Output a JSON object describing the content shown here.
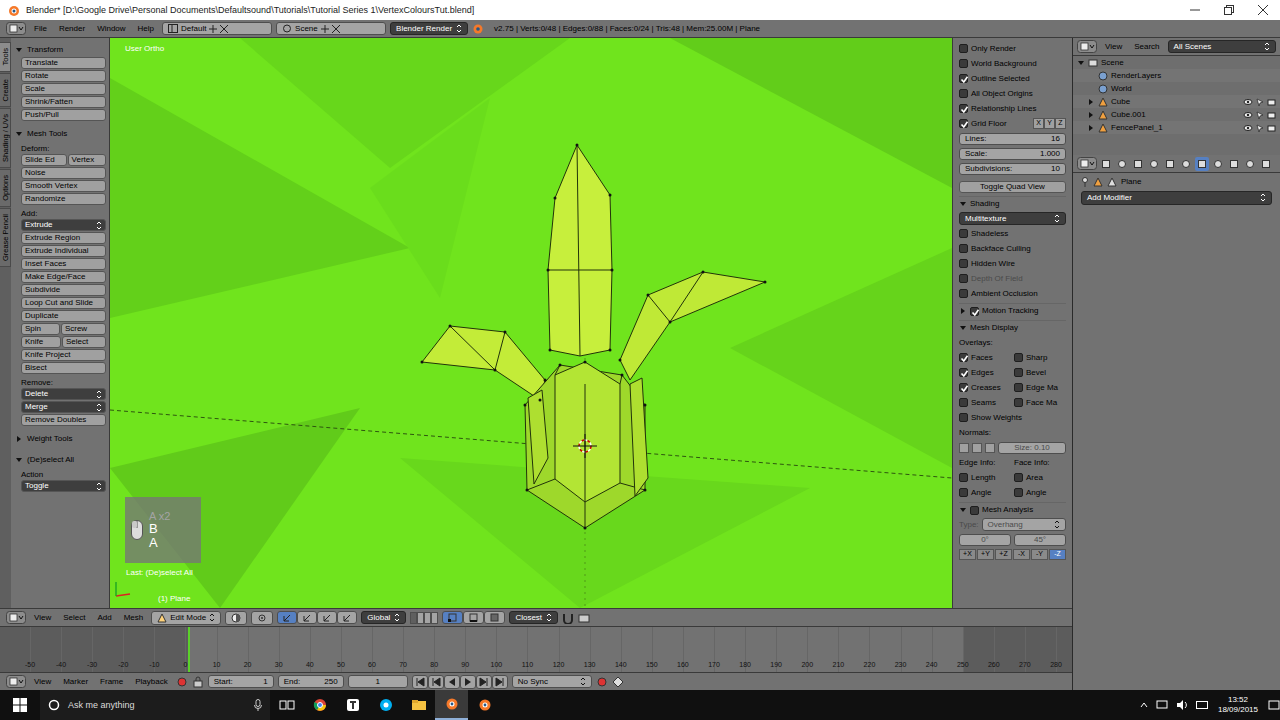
{
  "window": {
    "title": "Blender* [D:\\Google Drive\\Personal Documents\\Defaultsound\\Tutorials\\Tutorial Series 1\\VertexColoursTut.blend]"
  },
  "info_header": {
    "menus": [
      "File",
      "Render",
      "Window",
      "Help"
    ],
    "layout": "Default",
    "scene": "Scene",
    "engine": "Blender Render",
    "stats": "v2.75 | Verts:0/48 | Edges:0/88 | Faces:0/24 | Tris:48 | Mem:25.00M | Plane"
  },
  "tool_shelf": {
    "tabs": [
      {
        "label": "Tools",
        "selected": true
      },
      {
        "label": "Create",
        "selected": false
      },
      {
        "label": "Shading / UVs",
        "selected": false
      },
      {
        "label": "Options",
        "selected": false
      },
      {
        "label": "Grease Pencil",
        "selected": false
      }
    ],
    "panels": [
      {
        "title": "Transform",
        "expanded": true,
        "items": [
          {
            "kind": "button",
            "labels": [
              "Translate"
            ]
          },
          {
            "kind": "button",
            "labels": [
              "Rotate"
            ]
          },
          {
            "kind": "button",
            "labels": [
              "Scale"
            ]
          },
          {
            "kind": "button",
            "labels": [
              "Shrink/Fatten"
            ]
          },
          {
            "kind": "button",
            "labels": [
              "Push/Pull"
            ]
          }
        ]
      },
      {
        "title": "Mesh Tools",
        "expanded": true,
        "items": [
          {
            "kind": "label",
            "labels": [
              "Deform:"
            ]
          },
          {
            "kind": "button",
            "labels": [
              "Slide Ed",
              "Vertex"
            ]
          },
          {
            "kind": "button",
            "labels": [
              "Noise"
            ]
          },
          {
            "kind": "button",
            "labels": [
              "Smooth Vertex"
            ]
          },
          {
            "kind": "button",
            "labels": [
              "Randomize"
            ]
          },
          {
            "kind": "label",
            "labels": [
              "Add:"
            ]
          },
          {
            "kind": "dropdown",
            "labels": [
              "Extrude"
            ]
          },
          {
            "kind": "button",
            "labels": [
              "Extrude Region"
            ]
          },
          {
            "kind": "button",
            "labels": [
              "Extrude Individual"
            ]
          },
          {
            "kind": "button",
            "labels": [
              "Inset Faces"
            ]
          },
          {
            "kind": "button",
            "labels": [
              "Make Edge/Face"
            ]
          },
          {
            "kind": "button",
            "labels": [
              "Subdivide"
            ]
          },
          {
            "kind": "button",
            "labels": [
              "Loop Cut and Slide"
            ]
          },
          {
            "kind": "button",
            "labels": [
              "Duplicate"
            ]
          },
          {
            "kind": "button",
            "labels": [
              "Spin",
              "Screw"
            ]
          },
          {
            "kind": "button",
            "labels": [
              "Knife",
              "Select"
            ]
          },
          {
            "kind": "button",
            "labels": [
              "Knife Project"
            ]
          },
          {
            "kind": "button",
            "labels": [
              "Bisect"
            ]
          },
          {
            "kind": "label",
            "labels": [
              "Remove:"
            ]
          },
          {
            "kind": "dropdown",
            "labels": [
              "Delete"
            ]
          },
          {
            "kind": "dropdown",
            "labels": [
              "Merge"
            ]
          },
          {
            "kind": "button",
            "labels": [
              "Remove Doubles"
            ]
          }
        ]
      },
      {
        "title": "Weight Tools",
        "expanded": false,
        "items": []
      }
    ],
    "operator": {
      "title": "(De)select All",
      "expanded": true,
      "label": "Action",
      "value": "Toggle"
    }
  },
  "viewport": {
    "view_label": "User Ortho",
    "object_label": "(1) Plane",
    "last_operator": "Last: (De)select All",
    "keys": [
      "A x2",
      "B",
      "A"
    ]
  },
  "view_properties": {
    "checks": [
      {
        "label": "Only Render",
        "checked": false
      },
      {
        "label": "World Background",
        "checked": false
      },
      {
        "label": "Outline Selected",
        "checked": true
      },
      {
        "label": "All Object Origins",
        "checked": false
      },
      {
        "label": "Relationship Lines",
        "checked": true
      }
    ],
    "grid_floor": {
      "label": "Grid Floor",
      "checked": true,
      "axes": [
        {
          "label": "X",
          "on": false
        },
        {
          "label": "Y",
          "on": false
        },
        {
          "label": "Z",
          "on": false
        }
      ]
    },
    "fields": [
      {
        "label": "Lines:",
        "value": "16"
      },
      {
        "label": "Scale:",
        "value": "1.000"
      },
      {
        "label": "Subdivisions:",
        "value": "10"
      }
    ],
    "quad_view": "Toggle Quad View",
    "shading_panel": {
      "title": "Shading",
      "expanded": true,
      "mode": "Multitexture",
      "checks": [
        {
          "label": "Shadeless",
          "checked": false,
          "disabled": false
        },
        {
          "label": "Backface Culling",
          "checked": false,
          "disabled": false
        },
        {
          "label": "Hidden Wire",
          "checked": false,
          "disabled": false
        },
        {
          "label": "Depth Of Field",
          "checked": false,
          "disabled": true
        },
        {
          "label": "Ambient Occlusion",
          "checked": false,
          "disabled": false
        }
      ]
    },
    "motion_tracking_panel": {
      "title": "Motion Tracking",
      "expanded": false,
      "checked": true
    },
    "mesh_display_panel": {
      "title": "Mesh Display",
      "expanded": true,
      "overlays_label": "Overlays:",
      "overlays": [
        {
          "label": "Faces",
          "checked": true
        },
        {
          "label": "Sharp",
          "checked": false
        },
        {
          "label": "Edges",
          "checked": true
        },
        {
          "label": "Bevel",
          "checked": false
        },
        {
          "label": "Creases",
          "checked": true
        },
        {
          "label": "Edge Ma",
          "checked": false
        },
        {
          "label": "Seams",
          "checked": false
        },
        {
          "label": "Face Ma",
          "checked": false
        }
      ],
      "show_weights": {
        "label": "Show Weights",
        "checked": false
      },
      "normals_label": "Normals:",
      "normal_buttons": [
        {
          "selected": false
        },
        {
          "selected": false
        },
        {
          "selected": false
        }
      ],
      "normals_size": "Size: 0.10",
      "edge_info_label": "Edge Info:",
      "face_info_label": "Face Info:",
      "edge_info": [
        {
          "label": "Length",
          "checked": false
        },
        {
          "label": "Angle",
          "checked": false
        }
      ],
      "face_info": [
        {
          "label": "Area",
          "checked": false
        },
        {
          "label": "Angle",
          "checked": false
        }
      ]
    },
    "mesh_analysis_panel": {
      "title": "Mesh Analysis",
      "expanded": true,
      "checked": false,
      "type_label": "Type:",
      "type": "Overhang",
      "min": "0°",
      "max": "45°"
    },
    "axis_buttons": [
      {
        "label": "+X",
        "selected": false
      },
      {
        "label": "+Y",
        "selected": false
      },
      {
        "label": "+Z",
        "selected": false
      },
      {
        "label": "-X",
        "selected": false
      },
      {
        "label": "-Y",
        "selected": false
      },
      {
        "label": "-Z",
        "selected": true
      }
    ]
  },
  "outliner": {
    "menus": [
      "View",
      "Search"
    ],
    "filter": "All Scenes",
    "tree": [
      {
        "label": "Scene",
        "expanded": true,
        "children": [
          {
            "label": "RenderLayers"
          },
          {
            "label": "World"
          },
          {
            "label": "Cube",
            "expanded": false
          },
          {
            "label": "Cube.001",
            "expanded": false
          },
          {
            "label": "FencePanel_1",
            "expanded": false
          }
        ]
      }
    ]
  },
  "properties": {
    "tabs": [
      {
        "selected": false
      },
      {
        "selected": false
      },
      {
        "selected": false
      },
      {
        "selected": false
      },
      {
        "selected": false
      },
      {
        "selected": false
      },
      {
        "selected": true
      },
      {
        "selected": false
      },
      {
        "selected": false
      },
      {
        "selected": false
      },
      {
        "selected": false
      }
    ],
    "context": "Plane",
    "add_modifier": "Add Modifier"
  },
  "viewport_header": {
    "menus": [
      "View",
      "Select",
      "Add",
      "Mesh"
    ],
    "mode": "Edit Mode",
    "orientation": "Global",
    "select_modes": [
      {
        "selected": true
      },
      {
        "selected": false
      },
      {
        "selected": false
      }
    ],
    "snap_target": "Closest"
  },
  "timeline": {
    "ticks": [
      "-50",
      "-40",
      "-30",
      "-20",
      "-10",
      "0",
      "10",
      "20",
      "30",
      "40",
      "50",
      "60",
      "70",
      "80",
      "90",
      "100",
      "110",
      "120",
      "130",
      "140",
      "150",
      "160",
      "170",
      "180",
      "190",
      "200",
      "210",
      "220",
      "230",
      "240",
      "250",
      "260",
      "270",
      "280"
    ],
    "menus": [
      "View",
      "Marker",
      "Frame",
      "Playback"
    ],
    "start_label": "Start:",
    "start": "1",
    "end_label": "End:",
    "end": "250",
    "current": "1",
    "sync": "No Sync"
  },
  "taskbar": {
    "search": "Ask me anything",
    "apps": [
      {
        "selected": false
      },
      {
        "selected": false
      },
      {
        "selected": false
      },
      {
        "selected": false
      },
      {
        "selected": false
      },
      {
        "selected": true
      },
      {
        "selected": false
      }
    ],
    "time": "13:52",
    "date": "18/09/2015"
  }
}
